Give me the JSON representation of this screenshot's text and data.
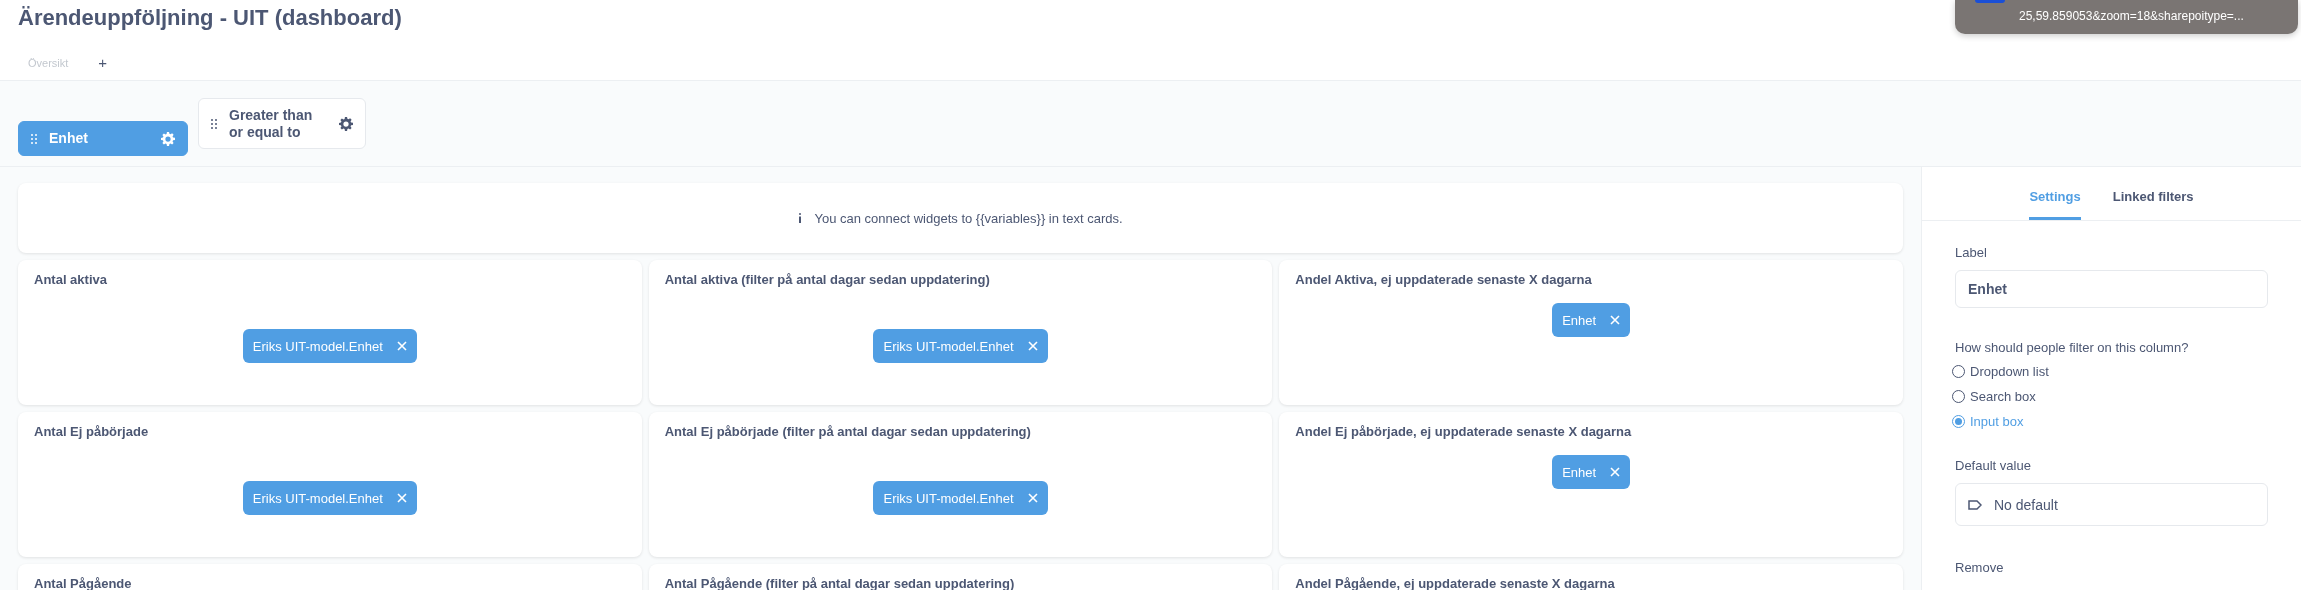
{
  "title": "Ärendeuppföljning - UIT (dashboard)",
  "tabs": [
    {
      "label": "Översikt"
    }
  ],
  "add_tab": "+",
  "tooltip": {
    "text": "25,59.859053&zoom=18&sharepoitype=..."
  },
  "filters": [
    {
      "label": "Enhet",
      "selected": true
    },
    {
      "label": "Greater than or equal to",
      "selected": false
    }
  ],
  "notice": {
    "text": "You can connect widgets to {{variables}} in text cards."
  },
  "cards": [
    {
      "title": "Antal aktiva",
      "chip": "Eriks UIT-model.Enhet"
    },
    {
      "title": "Antal aktiva (filter på antal dagar sedan uppdatering)",
      "chip": "Eriks UIT-model.Enhet"
    },
    {
      "title": "Andel Aktiva, ej uppdaterade senaste X dagarna",
      "chip": "Enhet"
    },
    {
      "title": "Antal Ej påbörjade",
      "chip": "Eriks UIT-model.Enhet"
    },
    {
      "title": "Antal Ej påbörjade (filter på antal dagar sedan uppdatering)",
      "chip": "Eriks UIT-model.Enhet"
    },
    {
      "title": "Andel Ej påbörjade, ej uppdaterade senaste X dagarna",
      "chip": "Enhet"
    },
    {
      "title": "Antal Pågående"
    },
    {
      "title": "Antal Pågående (filter på antal dagar sedan uppdatering)"
    },
    {
      "title": "Andel Pågående, ej uppdaterade senaste X dagarna"
    }
  ],
  "panel": {
    "tabs": [
      {
        "label": "Settings",
        "selected": true
      },
      {
        "label": "Linked filters",
        "selected": false
      }
    ],
    "label_field": {
      "label": "Label",
      "value": "Enhet"
    },
    "question": "How should people filter on this column?",
    "options": [
      {
        "label": "Dropdown list",
        "selected": false
      },
      {
        "label": "Search box",
        "selected": false
      },
      {
        "label": "Input box",
        "selected": true
      }
    ],
    "default_value": {
      "label": "Default value",
      "placeholder": "No default"
    },
    "remove": "Remove"
  }
}
